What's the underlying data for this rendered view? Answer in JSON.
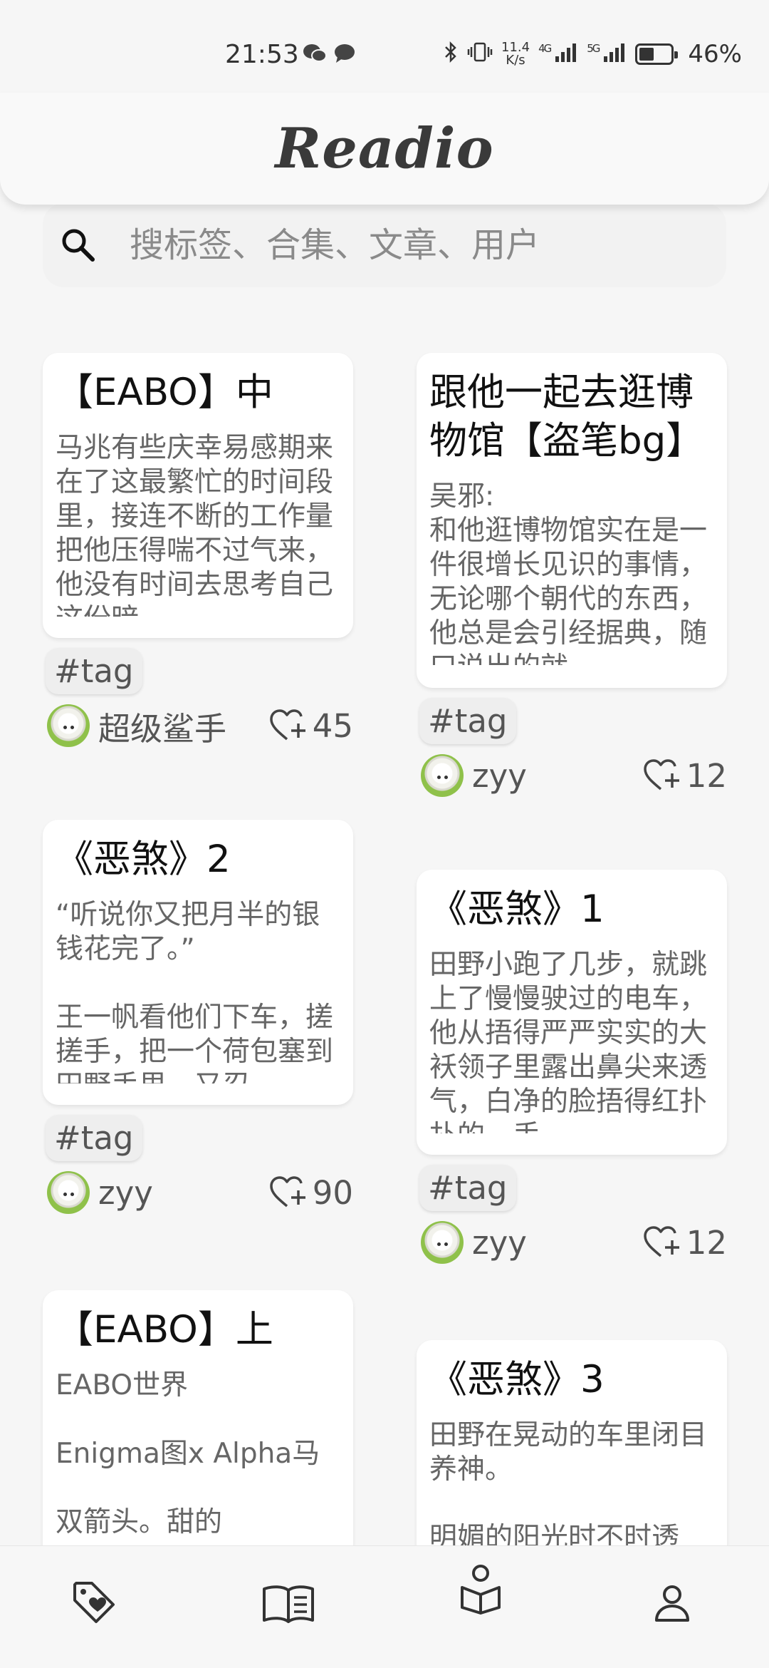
{
  "status_bar": {
    "time": "21:53",
    "speed_value": "11.4",
    "speed_unit": "K/s",
    "network_1": "4G",
    "network_2": "5G",
    "battery_percent": "46%"
  },
  "header": {
    "title": "Readio"
  },
  "search": {
    "placeholder": "搜标签、合集、文章、用户"
  },
  "feed": {
    "left": [
      {
        "title": "【EABO】中",
        "excerpt": "马兆有些庆幸易感期来在了这最繁忙的时间段里，接连不断的工作量把他压得喘不过气来，他没有时间去思考自己这份暗",
        "tag": "#tag",
        "author": "超级鲨手",
        "likes": "45"
      },
      {
        "title": "《恶煞》2",
        "excerpt": "“听说你又把月半的银钱花完了。”\n\n王一帆看他们下车，搓搓手，把一个荷包塞到田野手里，又忍",
        "tag": "#tag",
        "author": "zyy",
        "likes": "90"
      },
      {
        "title": "【EABO】上",
        "excerpt": "EABO世界\n\n Enigma图x Alpha马\n\n双箭头。甜的",
        "tag": "",
        "author": "",
        "likes": ""
      }
    ],
    "right": [
      {
        "title": "跟他一起去逛博物馆【盗笔bg】",
        "excerpt": "吴邪:\n和他逛博物馆实在是一件很增长见识的事情，无论哪个朝代的东西，他总是会引经据典，随口说出的就",
        "tag": "#tag",
        "author": "zyy",
        "likes": "12"
      },
      {
        "title": "《恶煞》1",
        "excerpt": "田野小跑了几步，就跳上了慢慢驶过的电车，他从捂得严严实实的大袄领子里露出鼻尖来透气，白净的脸捂得红扑扑的，手",
        "tag": "#tag",
        "author": "zyy",
        "likes": "12"
      },
      {
        "title": "《恶煞》3",
        "excerpt": "田野在晃动的车里闭目养神。\n\n明媚的阳光时不时透",
        "tag": "",
        "author": "",
        "likes": ""
      }
    ]
  },
  "bottom_nav": {
    "items": [
      {
        "icon": "tag-heart-icon"
      },
      {
        "icon": "open-book-icon"
      },
      {
        "icon": "reader-icon"
      },
      {
        "icon": "user-icon"
      }
    ],
    "active_index": 2
  },
  "colors": {
    "background": "#f6f6f6",
    "card": "#ffffff",
    "text_primary": "#111111",
    "text_secondary": "#666666"
  }
}
